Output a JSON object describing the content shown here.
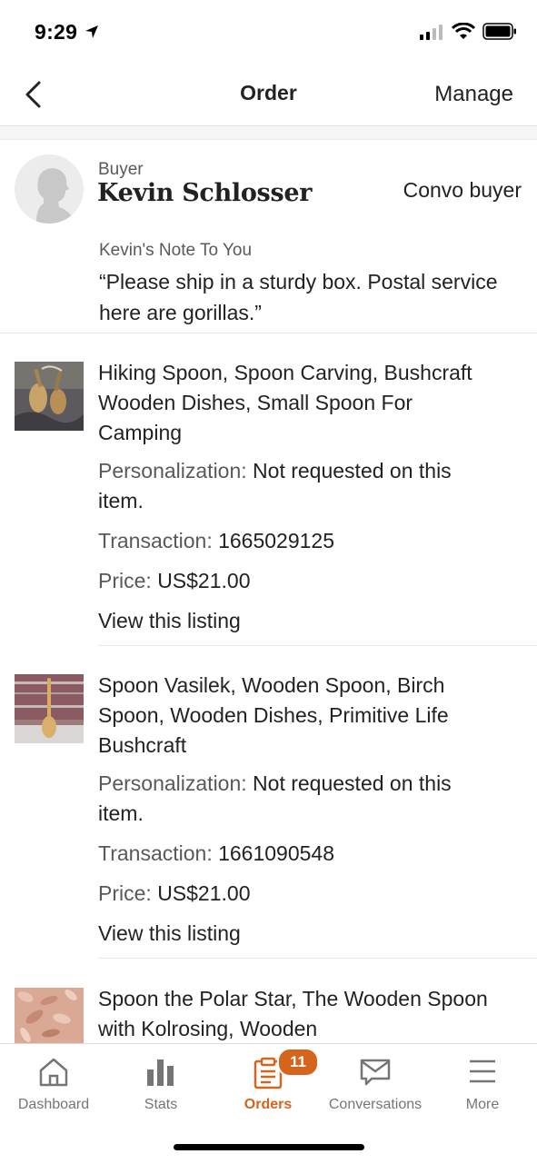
{
  "status": {
    "time": "9:29"
  },
  "nav": {
    "title": "Order",
    "manage": "Manage",
    "back_icon": "chevron-left-icon"
  },
  "buyer": {
    "label": "Buyer",
    "name": "Kevin Schlosser",
    "convo": "Convo buyer",
    "note_label": "Kevin's Note To You",
    "note": "“Please ship in a sturdy box.  Postal service here are gorillas.”"
  },
  "items": [
    {
      "title": "Hiking Spoon, Spoon Carving, Bushcraft Wooden Dishes, Small Spoon For Camping",
      "personalization_label": "Personalization:",
      "personalization_value": "Not requested on this item.",
      "transaction_label": "Transaction:",
      "transaction_value": "1665029125",
      "price_label": "Price:",
      "price_value": "US$21.00",
      "view_link": "View this listing"
    },
    {
      "title": "Spoon Vasilek, Wooden Spoon, Birch Spoon, Wooden Dishes, Primitive Life Bushcraft",
      "personalization_label": "Personalization:",
      "personalization_value": "Not requested on this item.",
      "transaction_label": "Transaction:",
      "transaction_value": "1661090548",
      "price_label": "Price:",
      "price_value": "US$21.00",
      "view_link": "View this listing"
    },
    {
      "title": "Spoon the Polar Star, The Wooden Spoon with Kolrosing, Wooden"
    }
  ],
  "tabs": [
    {
      "label": "Dashboard",
      "icon": "home-icon"
    },
    {
      "label": "Stats",
      "icon": "bar-chart-icon"
    },
    {
      "label": "Orders",
      "icon": "clipboard-icon",
      "badge": "11",
      "active": true
    },
    {
      "label": "Conversations",
      "icon": "envelope-icon"
    },
    {
      "label": "More",
      "icon": "menu-icon"
    }
  ],
  "colors": {
    "accent": "#d5641c",
    "text": "#222222",
    "muted": "#595959"
  }
}
